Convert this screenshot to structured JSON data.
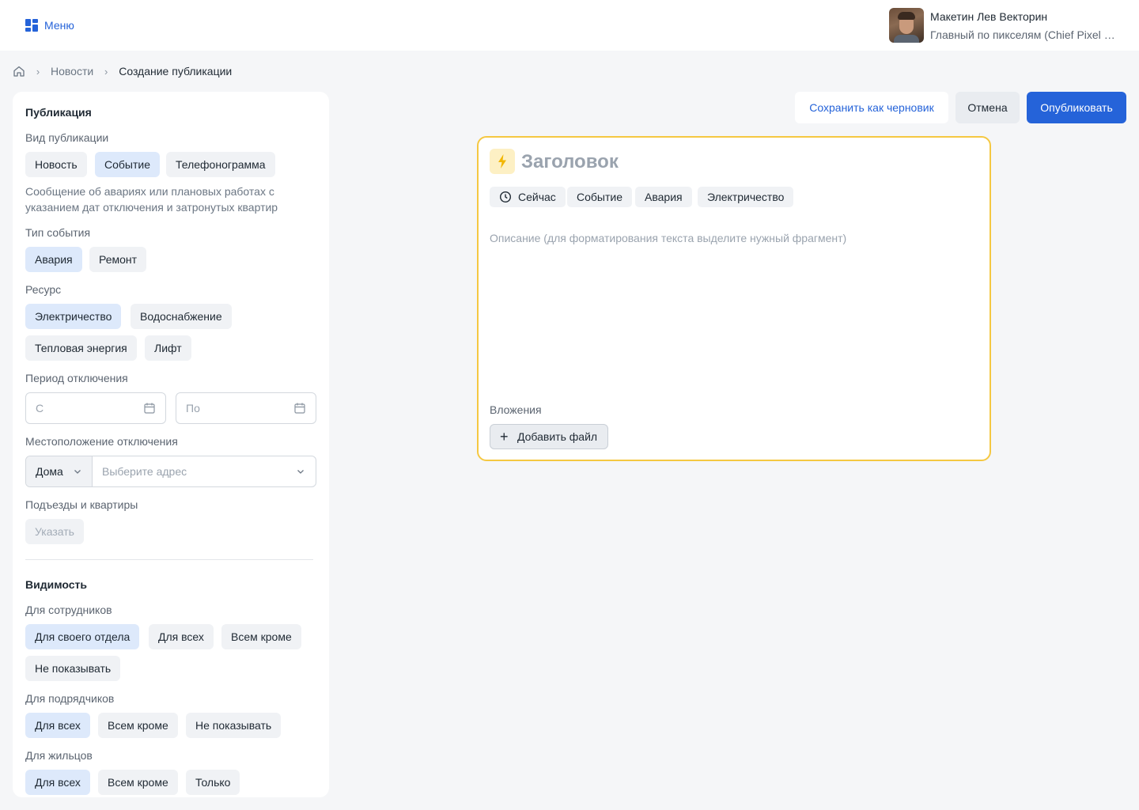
{
  "header": {
    "menu_label": "Меню",
    "user": {
      "name": "Макетин Лев Векторин",
      "role": "Главный по пикселям (Chief Pixel Officer)"
    }
  },
  "breadcrumb": {
    "items": [
      "Новости",
      "Создание публикации"
    ]
  },
  "actions": {
    "draft": "Сохранить как черновик",
    "cancel": "Отмена",
    "publish": "Опубликовать"
  },
  "publication": {
    "title": "Публикация",
    "kind_label": "Вид публикации",
    "kinds": [
      "Новость",
      "Событие",
      "Телефонограмма"
    ],
    "kind_selected": "Событие",
    "kind_description": "Сообщение об авариях или плановых работах с указанием дат отключения и затронутых квартир",
    "event_type_label": "Тип события",
    "event_types": [
      "Авария",
      "Ремонт"
    ],
    "event_type_selected": "Авария",
    "resource_label": "Ресурс",
    "resources": [
      "Электричество",
      "Водоснабжение",
      "Тепловая энергия",
      "Лифт"
    ],
    "resource_selected": "Электричество",
    "period_label": "Период отключения",
    "period_from_placeholder": "С",
    "period_to_placeholder": "По",
    "location_label": "Местоположение отключения",
    "location_type": "Дома",
    "location_address_placeholder": "Выберите адрес",
    "entrances_label": "Подъезды и квартиры",
    "entrances_button": "Указать"
  },
  "visibility": {
    "title": "Видимость",
    "employees_label": "Для сотрудников",
    "employees_options": [
      "Для своего отдела",
      "Для всех",
      "Всем кроме",
      "Не показывать"
    ],
    "employees_selected": "Для своего отдела",
    "contractors_label": "Для подрядчиков",
    "contractors_options": [
      "Для всех",
      "Всем кроме",
      "Не показывать"
    ],
    "contractors_selected": "Для всех",
    "residents_label": "Для жильцов",
    "residents_options": [
      "Для всех",
      "Всем кроме",
      "Только"
    ],
    "residents_selected": "Для всех"
  },
  "card": {
    "icon": "lightning-icon",
    "title_placeholder": "Заголовок",
    "tags": [
      "Сейчас",
      "Событие",
      "Авария",
      "Электричество"
    ],
    "description_placeholder": "Описание (для форматирования текста выделите нужный фрагмент)",
    "attachments_label": "Вложения",
    "add_file_label": "Добавить файл"
  },
  "colors": {
    "accent": "#2563d9",
    "selected_chip": "#dde9fb",
    "card_border": "#f5c842"
  }
}
